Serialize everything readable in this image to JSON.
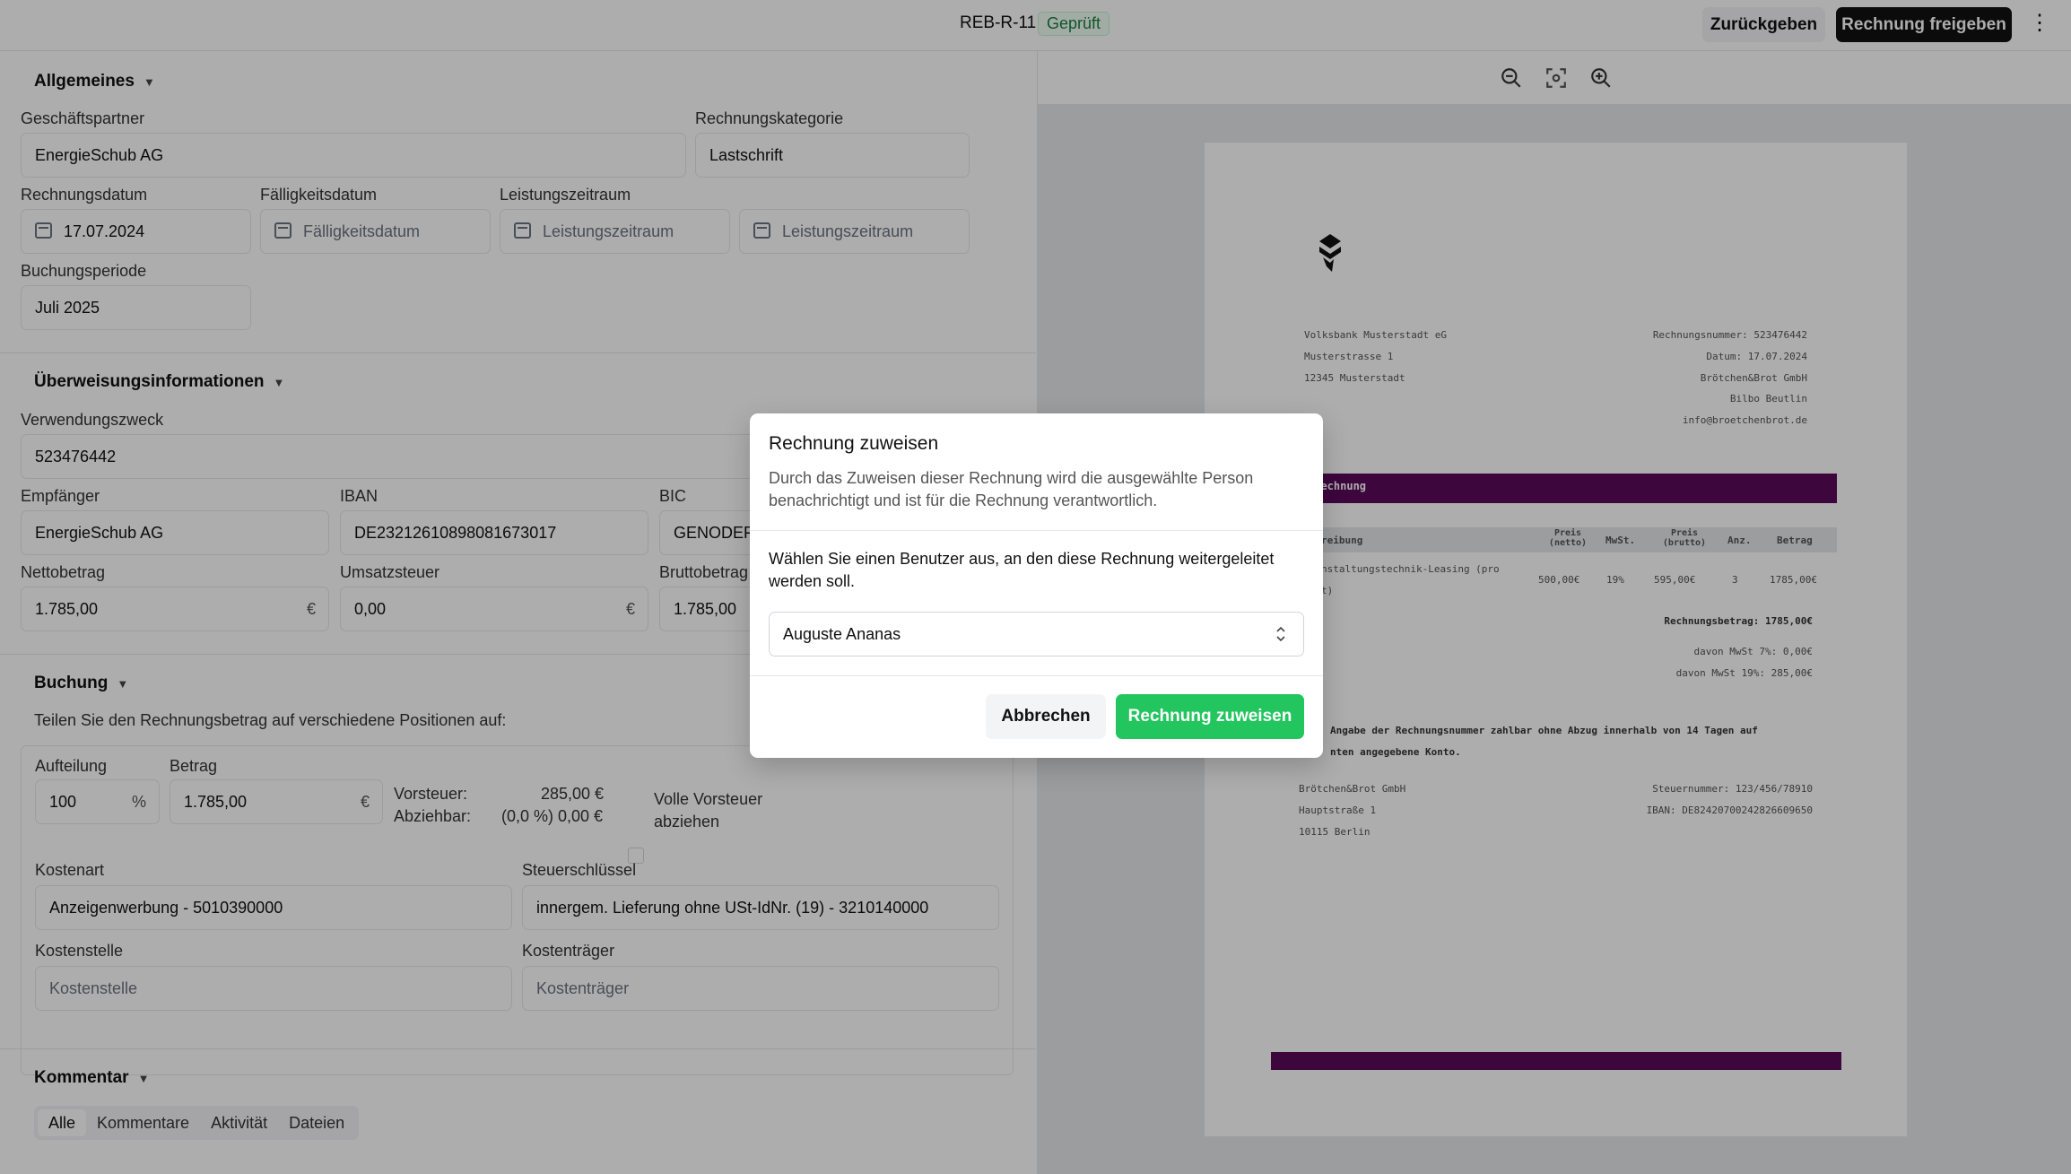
{
  "header": {
    "doc_id": "REB-R-11",
    "status": "Geprüft",
    "back_label": "Zurückgeben",
    "release_label": "Rechnung freigeben",
    "menu_glyph": "⋮"
  },
  "general": {
    "title": "Allgemeines",
    "partner_label": "Geschäftspartner",
    "partner_value": "EnergieSchub AG",
    "category_label": "Rechnungskategorie",
    "category_value": "Lastschrift",
    "invoice_date_label": "Rechnungsdatum",
    "invoice_date_value": "17.07.2024",
    "due_date_label": "Fälligkeitsdatum",
    "due_date_placeholder": "Fälligkeitsdatum",
    "service_period_label": "Leistungszeitraum",
    "service_start_placeholder": "Leistungszeitraum",
    "service_end_placeholder": "Leistungszeitraum",
    "booking_period_label": "Buchungsperiode",
    "booking_period_value": "Juli 2025"
  },
  "transfer": {
    "title": "Überweisungsinformationen",
    "purpose_label": "Verwendungszweck",
    "purpose_value": "523476442",
    "recipient_label": "Empfänger",
    "recipient_value": "EnergieSchub AG",
    "iban_label": "IBAN",
    "iban_value": "DE23212610898081673017",
    "bic_label": "BIC",
    "bic_value": "GENODEF",
    "net_label": "Nettobetrag",
    "net_value": "1.785,00",
    "vat_label": "Umsatzsteuer",
    "vat_value": "0,00",
    "gross_label": "Bruttobetrag",
    "gross_value": "1.785,00",
    "currency": "€"
  },
  "booking": {
    "title": "Buchung",
    "hint": "Teilen Sie den Rechnungsbetrag auf verschiedene Positionen auf:",
    "split_label": "Aufteilung",
    "split_value": "100",
    "split_unit": "%",
    "amount_label": "Betrag",
    "amount_value": "1.785,00",
    "amount_unit": "€",
    "input_tax_label": "Vorsteuer:",
    "input_tax_value": "285,00 €",
    "deductible_label": "Abziehbar:",
    "deductible_value": "(0,0 %) 0,00 €",
    "full_tax_label": "Volle Vorsteuer abziehen",
    "cost_type_label": "Kostenart",
    "cost_type_value": "Anzeigenwerbung - 5010390000",
    "tax_key_label": "Steuerschlüssel",
    "tax_key_value": "innergem. Lieferung ohne USt-IdNr. (19) - 3210140000",
    "cost_center_label": "Kostenstelle",
    "cost_center_placeholder": "Kostenstelle",
    "cost_unit_label": "Kostenträger",
    "cost_unit_placeholder": "Kostenträger"
  },
  "comments": {
    "title": "Kommentar",
    "tabs": [
      "Alle",
      "Kommentare",
      "Aktivität",
      "Dateien"
    ]
  },
  "pdf": {
    "sender_lines": [
      "Volksbank Musterstadt eG",
      "Musterstrasse 1",
      "12345 Musterstadt"
    ],
    "meta_lines": [
      "Rechnungsnummer: 523476442",
      "Datum: 17.07.2024",
      "Brötchen&Brot GmbH",
      "Bilbo Beutlin",
      "info@broetchenbrot.de"
    ],
    "heading": "orechnung",
    "table_headers": [
      "reibung",
      "Preis (netto)",
      "MwSt.",
      "Preis (brutto)",
      "Anz.",
      "Betrag"
    ],
    "row_desc_1": "nstaltungstechnik-Leasing (pro",
    "row_desc_2": "t)",
    "row_values": [
      "500,00€",
      "19%",
      "595,00€",
      "3",
      "1785,00€"
    ],
    "total": "Rechnungsbetrag: 1785,00€",
    "tax7": "davon MwSt 7%: 0,00€",
    "tax19": "davon MwSt 19%: 285,00€",
    "note_1": "Angabe der Rechnungsnummer zahlbar ohne Abzug innerhalb von 14 Tagen auf",
    "note_2": "nten angegebene Konto.",
    "footer_left": [
      "Brötchen&Brot GmbH",
      "Hauptstraße 1",
      "10115 Berlin"
    ],
    "footer_right": [
      "Steuernummer: 123/456/78910",
      "IBAN: DE82420700242826609650"
    ]
  },
  "modal": {
    "title": "Rechnung zuweisen",
    "description": "Durch das Zuweisen dieser Rechnung wird die ausgewählte Person benachrichtigt und ist für die Rechnung verantwortlich.",
    "prompt": "Wählen Sie einen Benutzer aus, an den diese Rechnung weitergeleitet werden soll.",
    "selected_user": "Auguste Ananas",
    "cancel_label": "Abbrechen",
    "assign_label": "Rechnung zuweisen"
  },
  "colors": {
    "assign_button": "#22c55e",
    "pdf_accent": "#5b0a5b",
    "status_badge": "#15803d"
  }
}
